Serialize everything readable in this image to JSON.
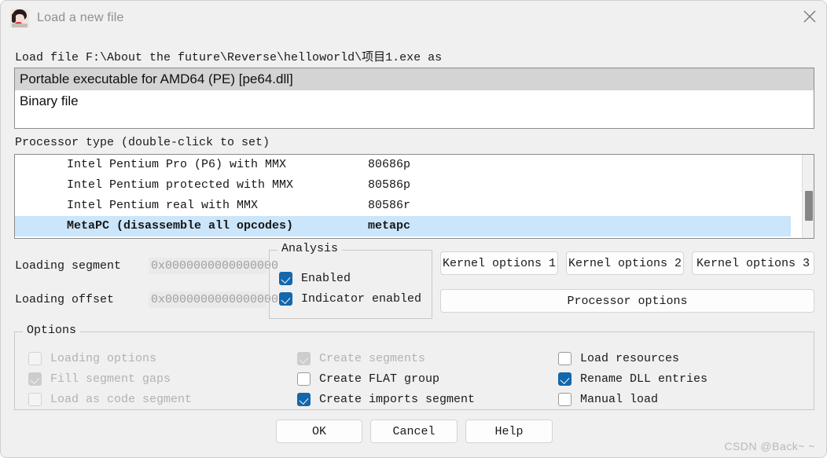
{
  "window": {
    "title": "Load a new file",
    "close_label": "✕"
  },
  "file_label": "Load file F:\\About the future\\Reverse\\helloworld\\项目1.exe as",
  "file_types": [
    {
      "label": "Portable executable for AMD64 (PE) [pe64.dll]",
      "selected": true
    },
    {
      "label": "Binary file",
      "selected": false
    }
  ],
  "processor": {
    "label": "Processor type (double-click to set)",
    "rows": [
      {
        "name": "Intel Pentium Pro (P6) with MMX",
        "code": "80686p",
        "selected": false
      },
      {
        "name": "Intel Pentium protected with MMX",
        "code": "80586p",
        "selected": false
      },
      {
        "name": "Intel Pentium real with MMX",
        "code": "80586r",
        "selected": false
      },
      {
        "name": "MetaPC (disassemble all opcodes)",
        "code": "metapc",
        "selected": true
      }
    ]
  },
  "loading": {
    "segment_label": "Loading segment",
    "segment_value": "0x0000000000000000",
    "offset_label": "Loading offset",
    "offset_value": "0x0000000000000000"
  },
  "analysis": {
    "legend": "Analysis",
    "items": [
      {
        "label": "Enabled",
        "checked": true,
        "disabled": false
      },
      {
        "label": "Indicator enabled",
        "checked": true,
        "disabled": false
      }
    ]
  },
  "kernel_buttons": {
    "kernel1": "Kernel options 1",
    "kernel2": "Kernel options 2",
    "kernel3": "Kernel options 3",
    "processor": "Processor options"
  },
  "options": {
    "legend": "Options",
    "column1": [
      {
        "label": "Loading options",
        "checked": false,
        "disabled": true
      },
      {
        "label": "Fill segment gaps",
        "checked": true,
        "disabled": true
      },
      {
        "label": "Load as code segment",
        "checked": false,
        "disabled": true
      }
    ],
    "column2": [
      {
        "label": "Create segments",
        "checked": true,
        "disabled": true
      },
      {
        "label": "Create FLAT group",
        "checked": false,
        "disabled": false
      },
      {
        "label": "Create imports segment",
        "checked": true,
        "disabled": false
      }
    ],
    "column3": [
      {
        "label": "Load resources",
        "checked": false,
        "disabled": false
      },
      {
        "label": "Rename DLL entries",
        "checked": true,
        "disabled": false
      },
      {
        "label": "Manual load",
        "checked": false,
        "disabled": false
      }
    ]
  },
  "buttons": {
    "ok": "OK",
    "cancel": "Cancel",
    "help": "Help"
  },
  "watermark": "CSDN @Back~ ~",
  "colors": {
    "accent_check": "#1267ad",
    "selection_blue": "#cbe5fb",
    "selection_gray": "#d4d4d4",
    "window_bg": "#f0f0f0"
  }
}
